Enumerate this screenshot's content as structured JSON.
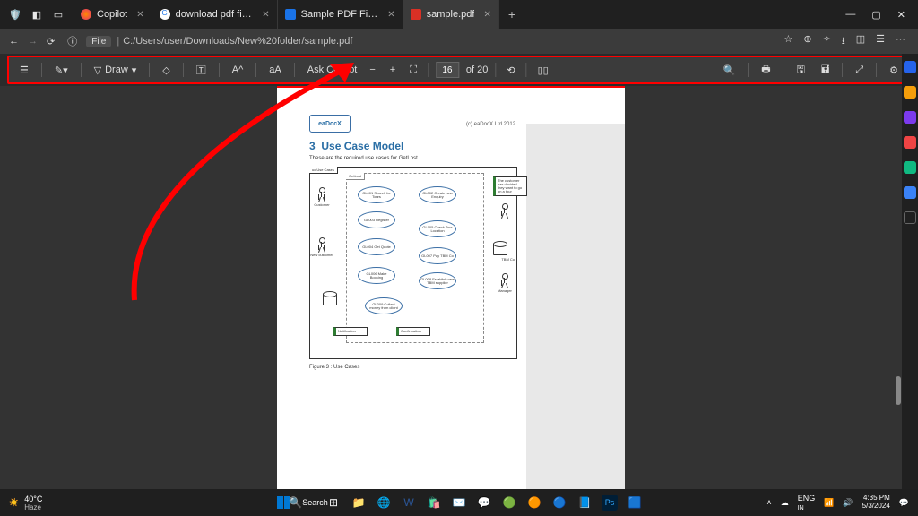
{
  "tabs": [
    {
      "label": "Copilot",
      "favcolor": "#ff5f1f"
    },
    {
      "label": "download pdf file sample - Sea…",
      "favcolor": "#1a73e8"
    },
    {
      "label": "Sample PDF Files Download - G…",
      "favcolor": "#1a73e8"
    },
    {
      "label": "sample.pdf",
      "favcolor": "#d93025"
    }
  ],
  "address": {
    "protocol_chip": "File",
    "url": "C:/Users/user/Downloads/New%20folder/sample.pdf"
  },
  "toolbar": {
    "draw": "Draw",
    "ask_copilot": "Ask Copilot",
    "read_aloud": "aA",
    "page_current": "16",
    "page_total": "of 20"
  },
  "pdf": {
    "logo": "eaDocX",
    "copyright": "(c) eaDocX Ltd 2012",
    "heading_num": "3",
    "heading": "Use Case Model",
    "subtitle": "These are the required use cases for GetLost.",
    "figure_caption": "Figure 3 : Use Cases",
    "page_number": "16",
    "diagram_zone": "uc Use Cases",
    "system_box": "GetLost",
    "actors": {
      "a1": "Customer",
      "a2": "New customer",
      "a3": "TBM Co",
      "a4": "Manager"
    },
    "usecases": {
      "u1": "GL001 Search for Tours",
      "u2": "GL002 Create new Enquiry",
      "u3": "GL003 Register",
      "u4": "GL004 Get Quote",
      "u5": "GL005 Check Tour Location",
      "u6": "GL006 Make Booking",
      "u7": "GL007 Pay TBM Co",
      "u8": "GL008 Establish new TBM supplier",
      "u9": "GL009 Collect money from client"
    },
    "notes": {
      "n1": "The customer has decided they want to go on a tour",
      "n2": "Notification",
      "n3": "Confirmation"
    }
  },
  "system": {
    "weather_temp": "40°C",
    "weather_cond": "Haze",
    "lang1": "ENG",
    "lang2": "IN",
    "time": "4:35 PM",
    "date": "5/3/2024"
  }
}
